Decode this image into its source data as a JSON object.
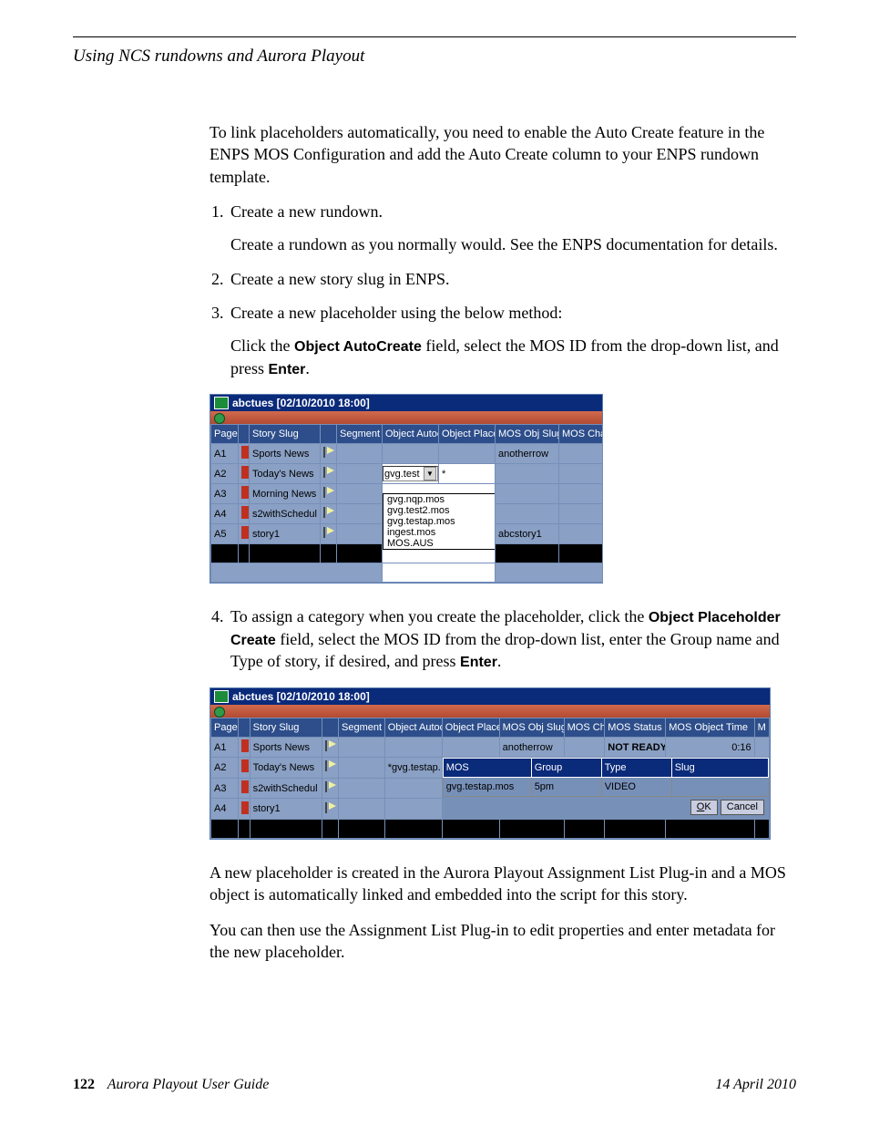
{
  "header": {
    "section_title": "Using NCS rundowns and Aurora Playout"
  },
  "intro": {
    "p1": "To link placeholders automatically, you need to enable the Auto Create feature in the ENPS MOS Configuration and add the Auto Create column to your ENPS rundown template."
  },
  "steps": {
    "s1": "Create a new rundown.",
    "s1_sub": "Create a rundown as you normally would. See the ENPS documentation for details.",
    "s2": "Create a new story slug in ENPS.",
    "s3": "Create a new placeholder using the below method:",
    "s3_click_a": "Click the ",
    "s3_click_field": "Object AutoCreate",
    "s3_click_b": " field, select the MOS ID from the drop-down list, and press ",
    "s3_enter": "Enter",
    "s3_click_c": ".",
    "s4_a": "To assign a category when you create the placeholder, click the ",
    "s4_field": "Object Placeholder Create",
    "s4_b": " field, select the MOS ID from the drop-down list, enter the Group name and Type of story, if desired, and press ",
    "s4_enter": "Enter",
    "s4_c": "."
  },
  "outro": {
    "p1": "A new placeholder is created in the Aurora Playout Assignment List Plug-in and a MOS object is automatically linked and embedded into the script for this story.",
    "p2": "You can then use the Assignment List Plug-in to edit properties and enter metadata for the new placeholder."
  },
  "footer": {
    "page_number": "122",
    "doc_title": "Aurora Playout User Guide",
    "date": "14 April 2010"
  },
  "screenshot1": {
    "title": "abctues [02/10/2010 18:00]",
    "columns": [
      "Page",
      "",
      "Story Slug",
      "",
      "Segment",
      "Object Autocreate",
      "Object Placeholder",
      "MOS Obj Slug",
      "MOS Channel"
    ],
    "rows": [
      {
        "page": "A1",
        "slug": "Sports News",
        "obj_slug": "anotherrow"
      },
      {
        "page": "A2",
        "slug": "Today's News",
        "autocreate": "gvg.test"
      },
      {
        "page": "A3",
        "slug": "Morning News"
      },
      {
        "page": "A4",
        "slug": "s2withSchedul"
      },
      {
        "page": "A5",
        "slug": "story1",
        "obj_slug": "abcstory1"
      }
    ],
    "dropdown_items": [
      "gvg.nqp.mos",
      "gvg.test2.mos",
      "gvg.testap.mos",
      "ingest.mos",
      "MOS.AUS"
    ]
  },
  "screenshot2": {
    "title": "abctues [02/10/2010 18:00]",
    "columns": [
      "Page",
      "",
      "Story Slug",
      "",
      "Segment",
      "Object Autocreate",
      "Object Placeholder",
      "MOS Obj Slug",
      "MOS Channel",
      "MOS Status",
      "MOS Object Time",
      "M"
    ],
    "rows": [
      {
        "page": "A1",
        "slug": "Sports News",
        "obj_slug": "anotherrow",
        "status": "NOT READY",
        "time": "0:16"
      },
      {
        "page": "A2",
        "slug": "Today's News",
        "autocreate": "*gvg.testap."
      },
      {
        "page": "A3",
        "slug": "s2withSchedul"
      },
      {
        "page": "A4",
        "slug": "story1"
      }
    ],
    "popup": {
      "headers": [
        "MOS",
        "Group",
        "Type",
        "Slug"
      ],
      "mos": "gvg.testap.mos",
      "group": "5pm",
      "type": "VIDEO",
      "slug": "",
      "ok_label": "OK",
      "cancel_label": "Cancel"
    }
  }
}
